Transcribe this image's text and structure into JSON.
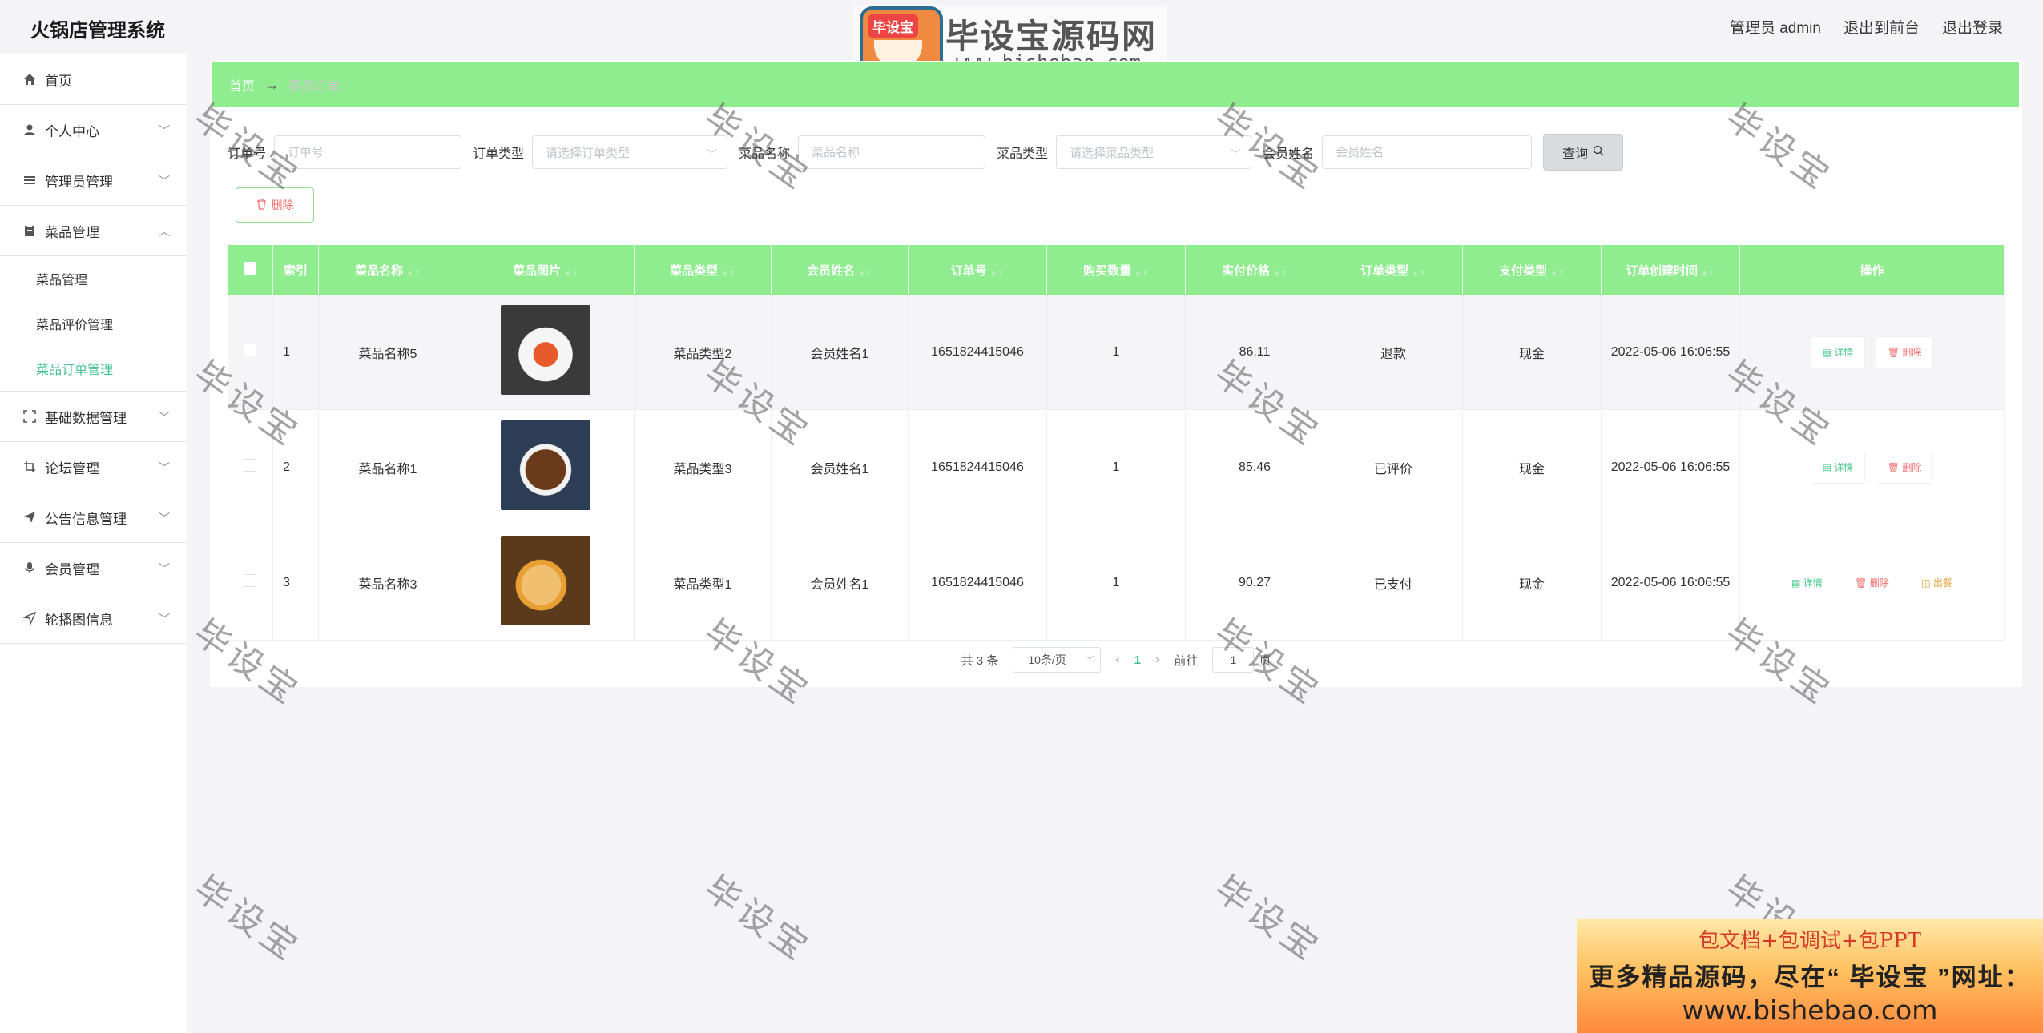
{
  "header": {
    "title": "火锅店管理系统",
    "admin": "管理员 admin",
    "to_front": "退出到前台",
    "logout": "退出登录"
  },
  "watermark": {
    "badge": "毕设宝",
    "brand": "毕设宝源码网",
    "url": "www.bishebao.com",
    "text": "毕设宝"
  },
  "sidebar": {
    "items": [
      {
        "label": "首页",
        "icon": "home-icon"
      },
      {
        "label": "个人中心",
        "icon": "user-icon"
      },
      {
        "label": "管理员管理",
        "icon": "list-icon"
      },
      {
        "label": "菜品管理",
        "icon": "clipboard-icon"
      },
      {
        "label": "基础数据管理",
        "icon": "fullscreen-icon"
      },
      {
        "label": "论坛管理",
        "icon": "crop-icon"
      },
      {
        "label": "公告信息管理",
        "icon": "send-icon"
      },
      {
        "label": "会员管理",
        "icon": "microphone-icon"
      },
      {
        "label": "轮播图信息",
        "icon": "location-icon"
      }
    ],
    "sub_items": [
      "菜品管理",
      "菜品评价管理",
      "菜品订单管理"
    ]
  },
  "breadcrumb": {
    "home": "首页",
    "arrow": "→",
    "current": "菜品订单"
  },
  "filters": {
    "order_no_label": "订单号",
    "order_no_placeholder": "订单号",
    "order_type_label": "订单类型",
    "order_type_placeholder": "请选择订单类型",
    "dish_name_label": "菜品名称",
    "dish_name_placeholder": "菜品名称",
    "dish_type_label": "菜品类型",
    "dish_type_placeholder": "请选择菜品类型",
    "member_label": "会员姓名",
    "member_placeholder": "会员姓名",
    "query_button": "查询"
  },
  "delete_button": "删除",
  "table": {
    "headers": [
      "索引",
      "菜品名称",
      "菜品图片",
      "菜品类型",
      "会员姓名",
      "订单号",
      "购买数量",
      "实付价格",
      "订单类型",
      "支付类型",
      "订单创建时间",
      "操作"
    ],
    "rows": [
      {
        "index": "1",
        "name": "菜品名称5",
        "type": "菜品类型2",
        "member": "会员姓名1",
        "order_no": "1651824415046",
        "qty": "1",
        "price": "86.11",
        "order_type": "退款",
        "pay": "现金",
        "time": "2022-05-06 16:06:55"
      },
      {
        "index": "2",
        "name": "菜品名称1",
        "type": "菜品类型3",
        "member": "会员姓名1",
        "order_no": "1651824415046",
        "qty": "1",
        "price": "85.46",
        "order_type": "已评价",
        "pay": "现金",
        "time": "2022-05-06 16:06:55"
      },
      {
        "index": "3",
        "name": "菜品名称3",
        "type": "菜品类型1",
        "member": "会员姓名1",
        "order_no": "1651824415046",
        "qty": "1",
        "price": "90.27",
        "order_type": "已支付",
        "pay": "现金",
        "time": "2022-05-06 16:06:55"
      }
    ],
    "actions": {
      "detail": "详情",
      "delete": "删除",
      "refund": "出餐"
    }
  },
  "pagination": {
    "total": "共 3 条",
    "page_size": "10条/页",
    "current": "1",
    "goto": "前往",
    "goto_value": "1",
    "page_unit": "页"
  },
  "ad": {
    "line1": "包文档+包调试+包PPT",
    "line2": "更多精品源码，尽在“ 毕设宝 ”网址：",
    "line3": "www.bishebao.com"
  }
}
